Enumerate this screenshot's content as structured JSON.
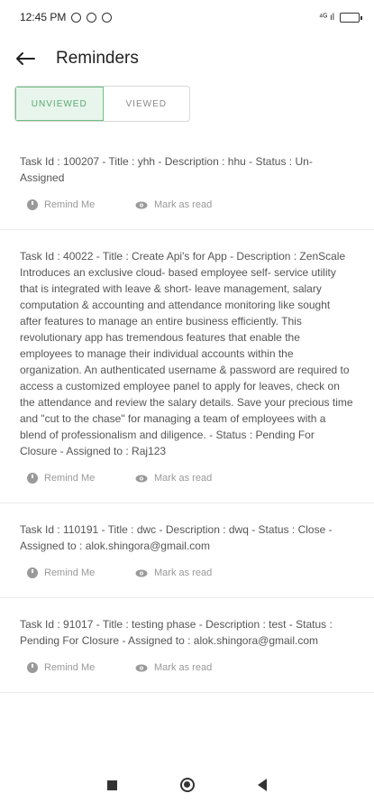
{
  "status_bar": {
    "time": "12:45 PM",
    "battery_level": 0.9,
    "right_text": "⁴ᴳ ıl"
  },
  "header": {
    "title": "Reminders"
  },
  "tabs": [
    {
      "label": "UNVIEWED",
      "active": true
    },
    {
      "label": "VIEWED",
      "active": false
    }
  ],
  "actions": {
    "remind": "Remind Me",
    "mark": "Mark as read"
  },
  "reminders": [
    {
      "text": "Task Id : 100207 - Title : yhh - Description : hhu - Status : Un-Assigned"
    },
    {
      "text": "Task Id : 40022 - Title : Create Api's for App - Description : ZenScale Introduces an exclusive cloud- based employee self- service utility that is integrated with leave & short- leave management, salary computation & accounting and attendance monitoring like sought after features to manage an entire business efficiently. This revolutionary app has tremendous features that enable the employees to manage their individual accounts within the organization. An authenticated username & password are required to access a customized employee panel to apply for leaves, check on the attendance and review the salary details. Save your precious time and \"cut to the chase\" for managing a team of employees with a blend of professionalism and diligence. - Status : Pending For Closure - Assigned to : Raj123"
    },
    {
      "text": "Task Id : 110191 - Title : dwc - Description : dwq - Status : Close - Assigned to : alok.shingora@gmail.com"
    },
    {
      "text": "Task Id : 91017 - Title : testing phase - Description : test - Status : Pending For Closure - Assigned to : alok.shingora@gmail.com"
    }
  ]
}
